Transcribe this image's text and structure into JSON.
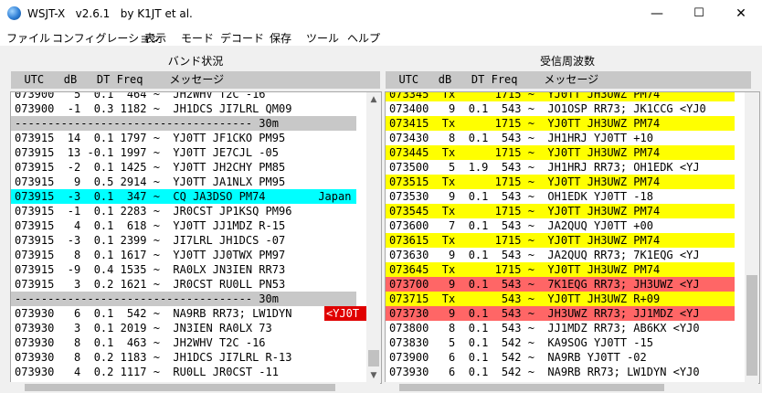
{
  "window": {
    "title": "WSJT-X   v2.6.1   by K1JT et al.",
    "minimize": "—",
    "maximize": "☐",
    "close": "✕"
  },
  "menu": [
    "ファイル",
    "コンフィグレーション",
    "表示",
    "モード",
    "デコード",
    "保存",
    "ツール",
    "ヘルプ"
  ],
  "left_panel": {
    "title": "バンド状況",
    "header": "  UTC   dB   DT Freq    メッセージ",
    "rows": [
      {
        "text": "073900   5  0.1  464 ~  JH2WHV T2C -16",
        "hl": ""
      },
      {
        "text": "073900  -1  0.3 1182 ~  JH1DCS JI7LRL QM09",
        "hl": ""
      },
      {
        "text": "------------------------------------ 30m",
        "hl": "gray"
      },
      {
        "text": "073915  14  0.1 1797 ~  YJ0TT JF1CKO PM95",
        "hl": ""
      },
      {
        "text": "073915  13 -0.1 1997 ~  YJ0TT JE7CJL -05",
        "hl": ""
      },
      {
        "text": "073915  -2  0.1 1425 ~  YJ0TT JH2CHY PM85",
        "hl": ""
      },
      {
        "text": "073915   9  0.5 2914 ~  YJ0TT JA1NLX PM95",
        "hl": ""
      },
      {
        "text": "073915  -3  0.1  347 ~  CQ JA3DSO PM74        Japan",
        "hl": "cyan"
      },
      {
        "text": "073915  -1  0.1 2283 ~  JR0CST JP1KSQ PM96",
        "hl": ""
      },
      {
        "text": "073915   4  0.1  618 ~  YJ0TT JJ1MDZ R-15",
        "hl": ""
      },
      {
        "text": "073915  -3  0.1 2399 ~  JI7LRL JH1DCS -07",
        "hl": ""
      },
      {
        "text": "073915   8  0.1 1617 ~  YJ0TT JJ0TWX PM97",
        "hl": ""
      },
      {
        "text": "073915  -9  0.4 1535 ~  RA0LX JN3IEN RR73",
        "hl": ""
      },
      {
        "text": "073915   3  0.2 1621 ~  JR0CST RU0LL PN53",
        "hl": ""
      },
      {
        "text": "------------------------------------ 30m",
        "hl": "gray"
      },
      {
        "text": "073930   6  0.1  542 ~  NA9RB RR73; LW1DYN",
        "hl": "",
        "tag": "<YJ0T"
      },
      {
        "text": "073930   3  0.1 2019 ~  JN3IEN RA0LX 73",
        "hl": ""
      },
      {
        "text": "073930   8  0.1  463 ~  JH2WHV T2C -16",
        "hl": ""
      },
      {
        "text": "073930   8  0.2 1183 ~  JH1DCS JI7LRL R-13",
        "hl": ""
      },
      {
        "text": "073930   4  0.2 1117 ~  RU0LL JR0CST -11",
        "hl": ""
      }
    ]
  },
  "right_panel": {
    "title": "受信周波数",
    "header": "  UTC   dB   DT Freq    メッセージ",
    "rows": [
      {
        "text": "073345  Tx      1715 ~  YJ0TT JH3UWZ PM74",
        "hl": "yellow"
      },
      {
        "text": "073400   9  0.1  543 ~  JO1OSP RR73; JK1CCG <YJ0",
        "hl": ""
      },
      {
        "text": "073415  Tx      1715 ~  YJ0TT JH3UWZ PM74",
        "hl": "yellow"
      },
      {
        "text": "073430   8  0.1  543 ~  JH1HRJ YJ0TT +10",
        "hl": ""
      },
      {
        "text": "073445  Tx      1715 ~  YJ0TT JH3UWZ PM74",
        "hl": "yellow"
      },
      {
        "text": "073500   5  1.9  543 ~  JH1HRJ RR73; OH1EDK <YJ",
        "hl": ""
      },
      {
        "text": "073515  Tx      1715 ~  YJ0TT JH3UWZ PM74",
        "hl": "yellow"
      },
      {
        "text": "073530   9  0.1  543 ~  OH1EDK YJ0TT -18",
        "hl": ""
      },
      {
        "text": "073545  Tx      1715 ~  YJ0TT JH3UWZ PM74",
        "hl": "yellow"
      },
      {
        "text": "073600   7  0.1  543 ~  JA2QUQ YJ0TT +00",
        "hl": ""
      },
      {
        "text": "073615  Tx      1715 ~  YJ0TT JH3UWZ PM74",
        "hl": "yellow"
      },
      {
        "text": "073630   9  0.1  543 ~  JA2QUQ RR73; 7K1EQG <YJ",
        "hl": ""
      },
      {
        "text": "073645  Tx      1715 ~  YJ0TT JH3UWZ PM74",
        "hl": "yellow"
      },
      {
        "text": "073700   9  0.1  543 ~  7K1EQG RR73; JH3UWZ <YJ",
        "hl": "red"
      },
      {
        "text": "073715  Tx       543 ~  YJ0TT JH3UWZ R+09",
        "hl": "yellow"
      },
      {
        "text": "073730   9  0.1  543 ~  JH3UWZ RR73; JJ1MDZ <YJ",
        "hl": "red"
      },
      {
        "text": "073800   8  0.1  543 ~  JJ1MDZ RR73; AB6KX <YJ0",
        "hl": ""
      },
      {
        "text": "073830   5  0.1  542 ~  KA9SOG YJ0TT -15",
        "hl": ""
      },
      {
        "text": "073900   6  0.1  542 ~  NA9RB YJ0TT -02",
        "hl": ""
      },
      {
        "text": "073930   6  0.1  542 ~  NA9RB RR73; LW1DYN <YJ0",
        "hl": ""
      }
    ]
  },
  "colors": {
    "yellow": "#ffff00",
    "cyan": "#00ffff",
    "red": "#ff6666",
    "gray": "#c8c8c8",
    "tag": "#e00000"
  }
}
